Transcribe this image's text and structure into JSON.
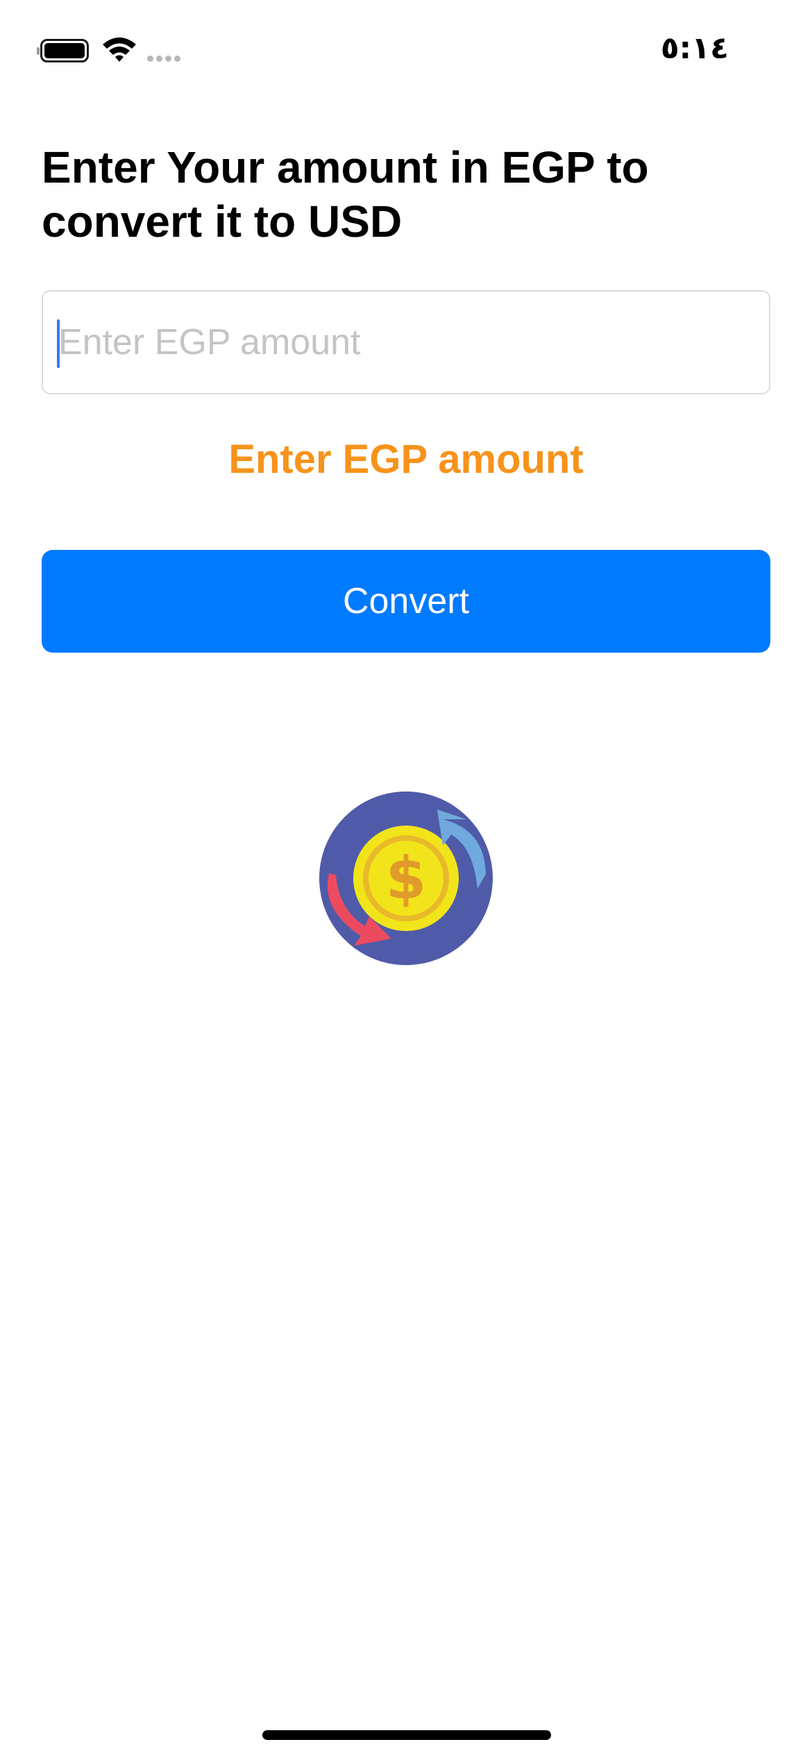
{
  "status_bar": {
    "time": "٥:١٤"
  },
  "main": {
    "title": "Enter Your amount in EGP to convert it to USD",
    "amount_input": {
      "value": "",
      "placeholder": "Enter EGP amount"
    },
    "result_text": "Enter EGP amount",
    "convert_label": "Convert"
  },
  "icons": {
    "battery": "battery-icon",
    "wifi": "wifi-icon",
    "cellular": "cellular-signal-icon",
    "logo": "currency-exchange-icon"
  },
  "colors": {
    "accent_blue": "#007aff",
    "result_orange": "#f7931a",
    "caret_blue": "#3478f6",
    "logo_circle": "#4f5ba8",
    "logo_coin": "#f2e41a",
    "logo_coin_ring": "#e8b92a",
    "logo_arrow_blue": "#6fa9dd",
    "logo_arrow_red": "#ec4b5f"
  }
}
